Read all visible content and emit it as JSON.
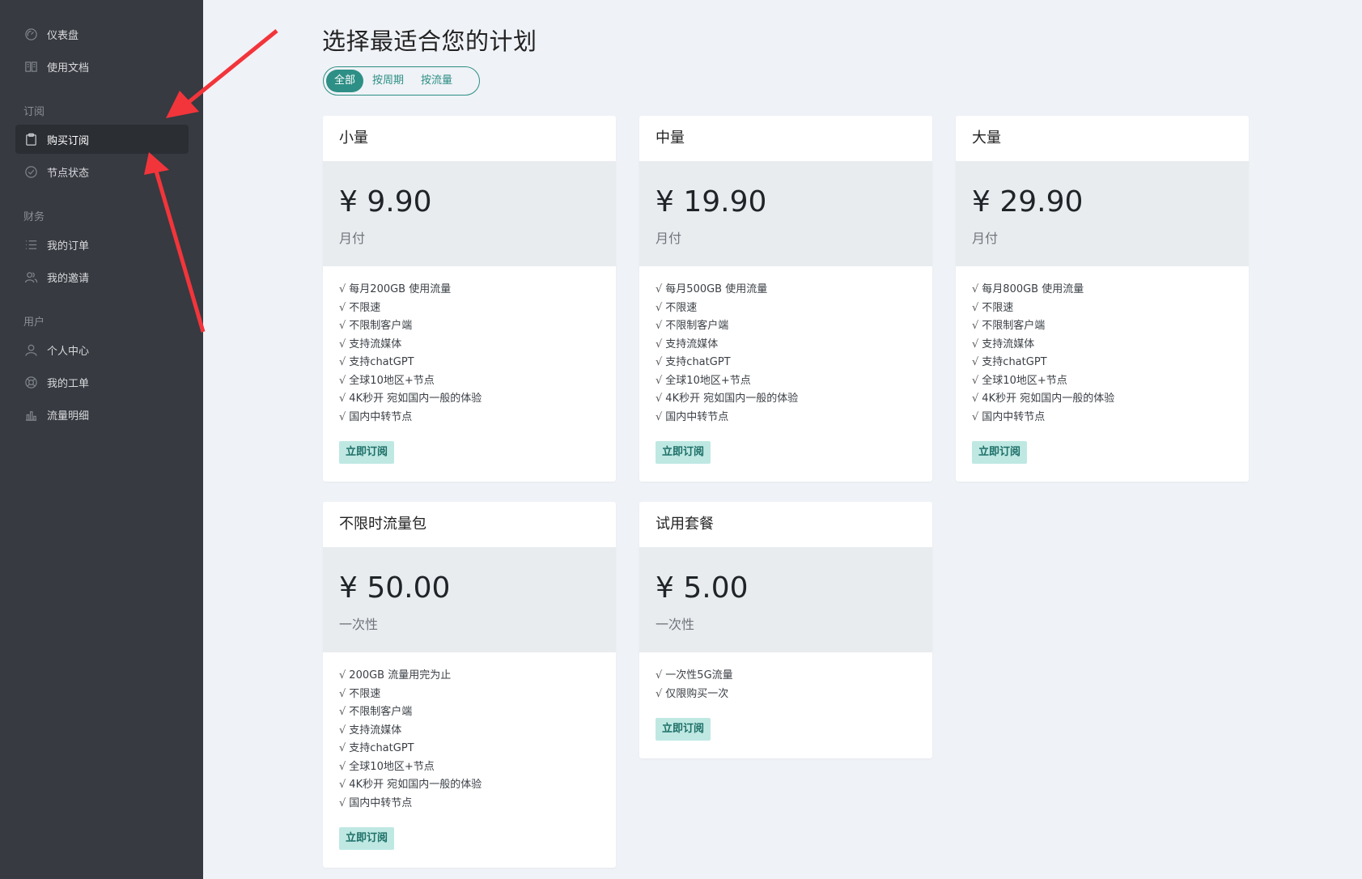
{
  "sidebar": {
    "top_items": [
      {
        "label": "仪表盘",
        "icon": "gauge-icon"
      },
      {
        "label": "使用文档",
        "icon": "book-icon"
      }
    ],
    "groups": [
      {
        "title": "订阅",
        "items": [
          {
            "label": "购买订阅",
            "icon": "clipboard-icon",
            "active": true
          },
          {
            "label": "节点状态",
            "icon": "check-circle-icon"
          }
        ]
      },
      {
        "title": "财务",
        "items": [
          {
            "label": "我的订单",
            "icon": "list-icon"
          },
          {
            "label": "我的邀请",
            "icon": "users-icon"
          }
        ]
      },
      {
        "title": "用户",
        "items": [
          {
            "label": "个人中心",
            "icon": "user-icon"
          },
          {
            "label": "我的工单",
            "icon": "support-icon"
          },
          {
            "label": "流量明细",
            "icon": "bar-chart-icon"
          }
        ]
      }
    ]
  },
  "main": {
    "title": "选择最适合您的计划",
    "filter": {
      "options": [
        "全部",
        "按周期",
        "按流量"
      ],
      "selected": "全部"
    },
    "plans": [
      {
        "name": "小量",
        "price": "¥ 9.90",
        "period": "月付",
        "features": [
          "每月200GB 使用流量",
          "不限速",
          "不限制客户端",
          "支持流媒体",
          "支持chatGPT",
          "全球10地区+节点",
          "4K秒开 宛如国内一般的体验",
          "国内中转节点"
        ],
        "button": "立即订阅"
      },
      {
        "name": "中量",
        "price": "¥ 19.90",
        "period": "月付",
        "features": [
          "每月500GB 使用流量",
          "不限速",
          "不限制客户端",
          "支持流媒体",
          "支持chatGPT",
          "全球10地区+节点",
          "4K秒开 宛如国内一般的体验",
          "国内中转节点"
        ],
        "button": "立即订阅"
      },
      {
        "name": "大量",
        "price": "¥ 29.90",
        "period": "月付",
        "features": [
          "每月800GB 使用流量",
          "不限速",
          "不限制客户端",
          "支持流媒体",
          "支持chatGPT",
          "全球10地区+节点",
          "4K秒开 宛如国内一般的体验",
          "国内中转节点"
        ],
        "button": "立即订阅"
      },
      {
        "name": "不限时流量包",
        "price": "¥ 50.00",
        "period": "一次性",
        "features": [
          "200GB 流量用完为止",
          "不限速",
          "不限制客户端",
          "支持流媒体",
          "支持chatGPT",
          "全球10地区+节点",
          "4K秒开 宛如国内一般的体验",
          "国内中转节点"
        ],
        "button": "立即订阅"
      },
      {
        "name": "试用套餐",
        "price": "¥ 5.00",
        "period": "一次性",
        "features": [
          "一次性5G流量",
          "仅限购买一次"
        ],
        "button": "立即订阅"
      }
    ],
    "check_mark": "√"
  },
  "colors": {
    "sidebar_bg": "#373a40",
    "accent": "#2d8f86",
    "button_bg": "#bfe8e3",
    "annotation_arrow": "#f2353b"
  }
}
